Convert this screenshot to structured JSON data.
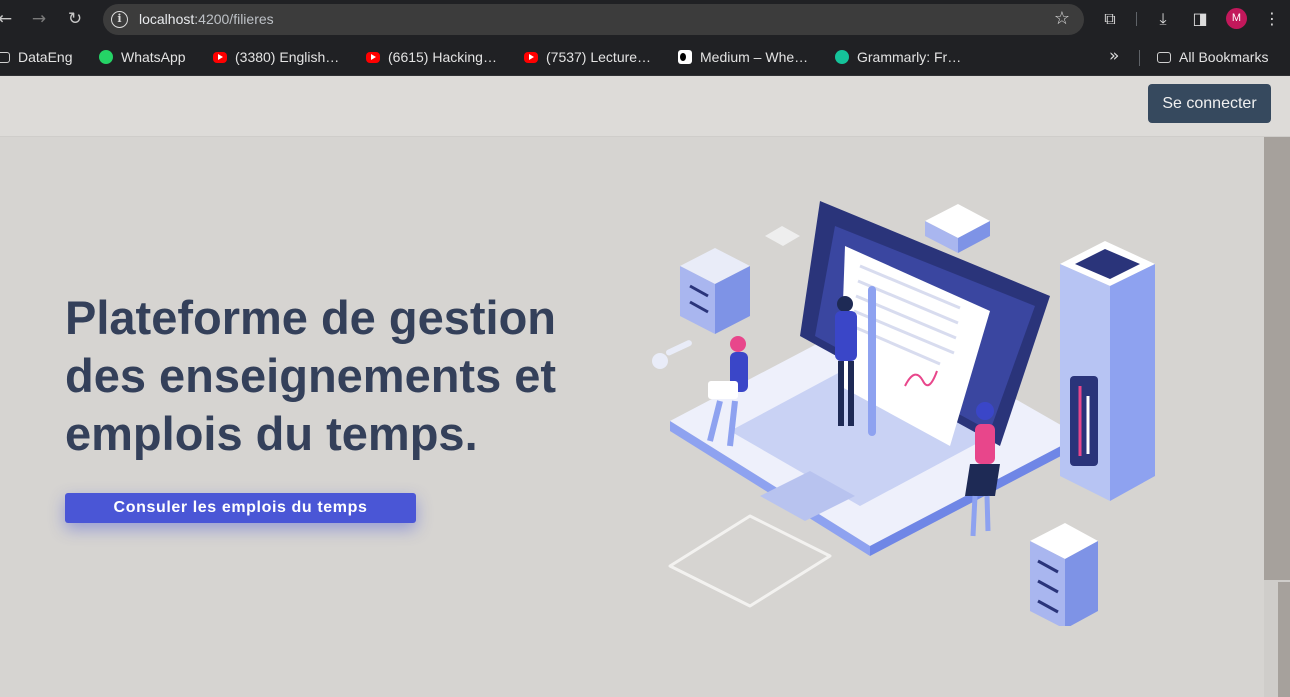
{
  "browser": {
    "url_host": "localhost",
    "url_path": ":4200/filieres",
    "profile_initial": "M",
    "bookmarks": [
      {
        "label": "DataEng",
        "icon": "folder-icon"
      },
      {
        "label": "WhatsApp",
        "icon": "whatsapp-icon"
      },
      {
        "label": "(3380) English…",
        "icon": "youtube-icon"
      },
      {
        "label": "(6615) Hacking…",
        "icon": "youtube-icon"
      },
      {
        "label": "(7537) Lecture…",
        "icon": "youtube-icon"
      },
      {
        "label": "Medium – Whe…",
        "icon": "medium-icon"
      },
      {
        "label": "Grammarly: Fr…",
        "icon": "grammarly-icon"
      }
    ],
    "all_bookmarks_label": "All Bookmarks"
  },
  "navbar": {
    "login_label": "Se connecter"
  },
  "hero": {
    "title_line1": "Plateforme de gestion",
    "title_line2": "des enseignements et",
    "title_line3": "emplois du temps.",
    "cta_label": "Consuler les emplois du temps"
  },
  "colors": {
    "page_bg": "#d6d4d1",
    "title": "#34405a",
    "cta": "#4a56d6",
    "login_button": "#36495e"
  }
}
